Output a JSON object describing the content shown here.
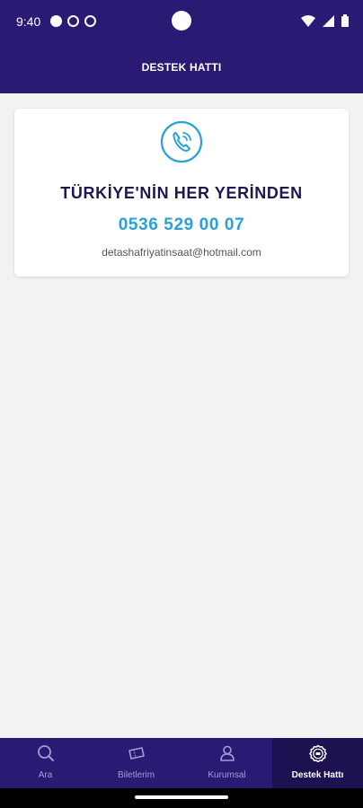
{
  "status_bar": {
    "time": "9:40"
  },
  "app_bar": {
    "title": "DESTEK HATTI"
  },
  "contact_card": {
    "heading": "TÜRKİYE'NİN HER YERİNDEN",
    "phone": "0536 529 00 07",
    "email": "detashafriyatinsaat@hotmail.com",
    "accent_color": "#2aa0d8"
  },
  "bottom_nav": {
    "items": [
      {
        "label": "Ara",
        "icon": "search-icon"
      },
      {
        "label": "Biletlerim",
        "icon": "ticket-icon"
      },
      {
        "label": "Kurumsal",
        "icon": "person-icon"
      },
      {
        "label": "Destek Hattı",
        "icon": "support-24-icon"
      }
    ],
    "active": "Destek Hattı"
  },
  "colors": {
    "primary": "#2b1a74",
    "active_tab": "#1d1151",
    "background": "#f2f2f2"
  }
}
